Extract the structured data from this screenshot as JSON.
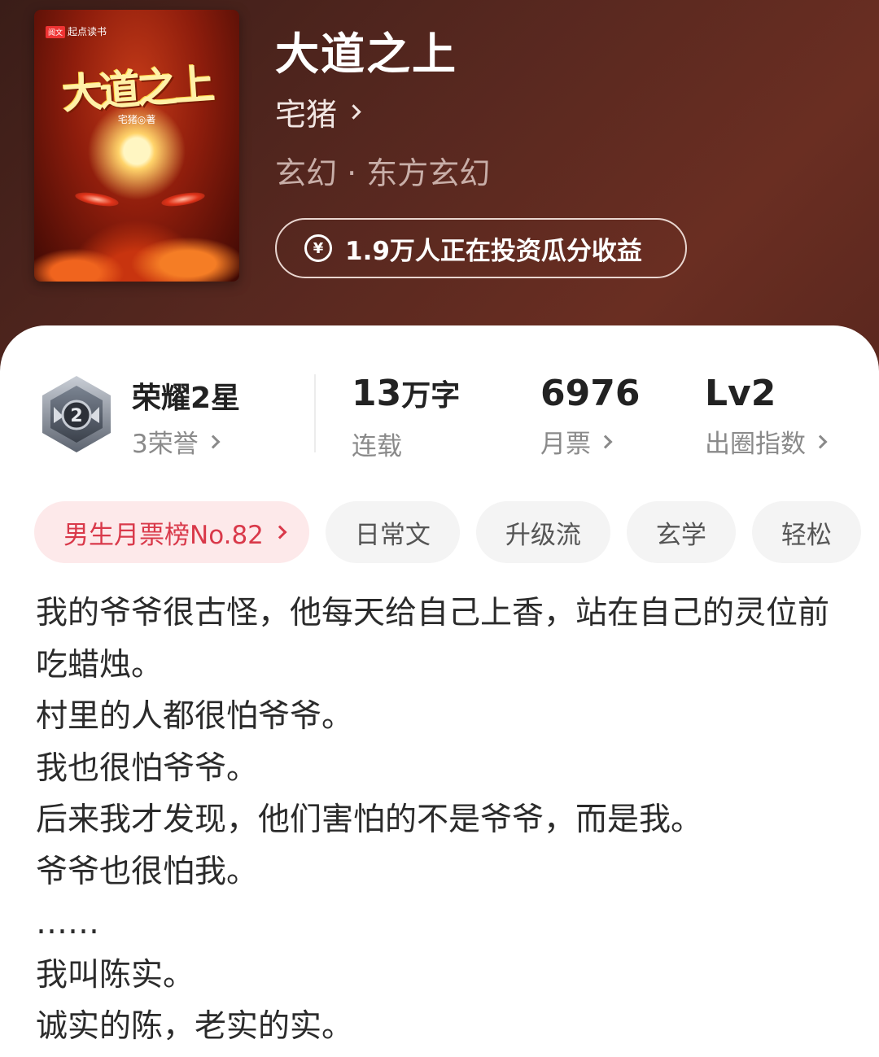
{
  "book": {
    "title": "大道之上",
    "author": "宅猪",
    "genre": "玄幻 · 东方玄幻",
    "invest_text": "1.9万人正在投资瓜分收益"
  },
  "cover": {
    "publisher_badge": "阅文",
    "publisher": "起点读书",
    "title": "大道之上",
    "author_line": "宅猪◎著"
  },
  "stats": {
    "honor_title": "荣耀2星",
    "honor_count": "3荣誉",
    "medal_number": "2",
    "words_value": "13",
    "words_unit": "万字",
    "words_label": "连载",
    "tickets_value": "6976",
    "tickets_label": "月票",
    "level_value": "Lv2",
    "level_label": "出圈指数"
  },
  "tags": {
    "rank": "男生月票榜No.82",
    "items": [
      "日常文",
      "升级流",
      "玄学",
      "轻松"
    ]
  },
  "intro": [
    "我的爷爷很古怪，他每天给自己上香，站在自己的灵位前吃蜡烛。",
    "村里的人都很怕爷爷。",
    "我也很怕爷爷。",
    "后来我才发现，他们害怕的不是爷爷，而是我。",
    "爷爷也很怕我。",
    "……",
    "我叫陈实。",
    "诚实的陈，老实的实。"
  ],
  "colors": {
    "header_bg": "#55271f",
    "rank_tag_text": "#d9394a",
    "rank_tag_bg": "#fde9ea"
  }
}
